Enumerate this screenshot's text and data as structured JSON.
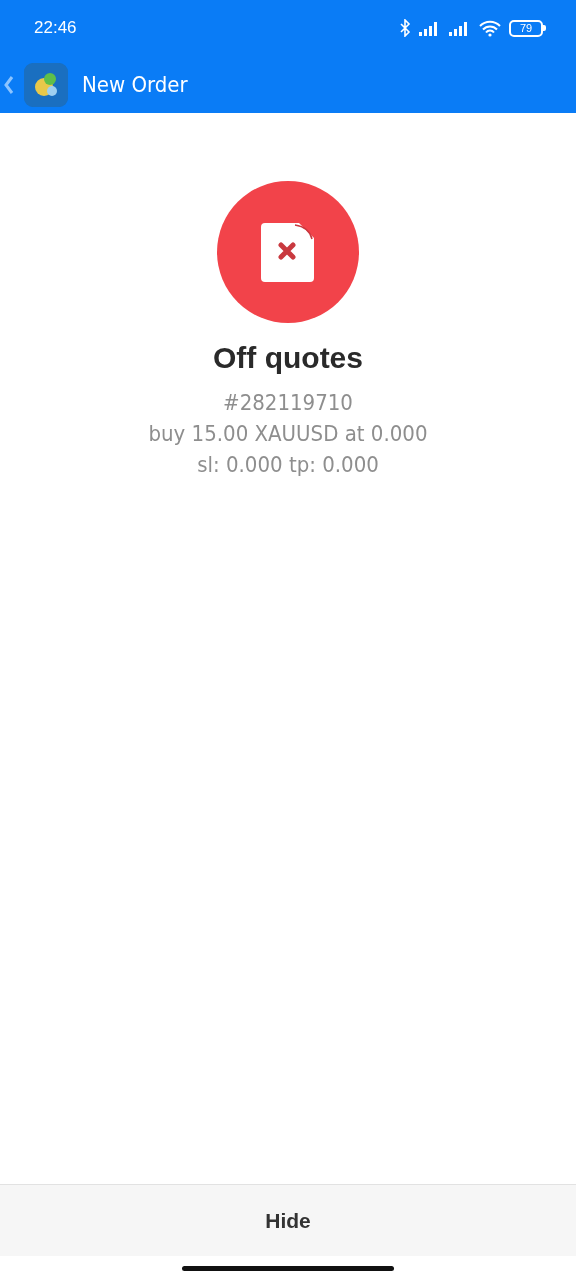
{
  "status_bar": {
    "time": "22:46",
    "battery": "79"
  },
  "app_bar": {
    "title": "New Order"
  },
  "result": {
    "title": "Off quotes",
    "lines": [
      "#282119710",
      "buy 15.00 XAUUSD at 0.000",
      "sl: 0.000 tp: 0.000"
    ]
  },
  "buttons": [
    "Hide"
  ]
}
